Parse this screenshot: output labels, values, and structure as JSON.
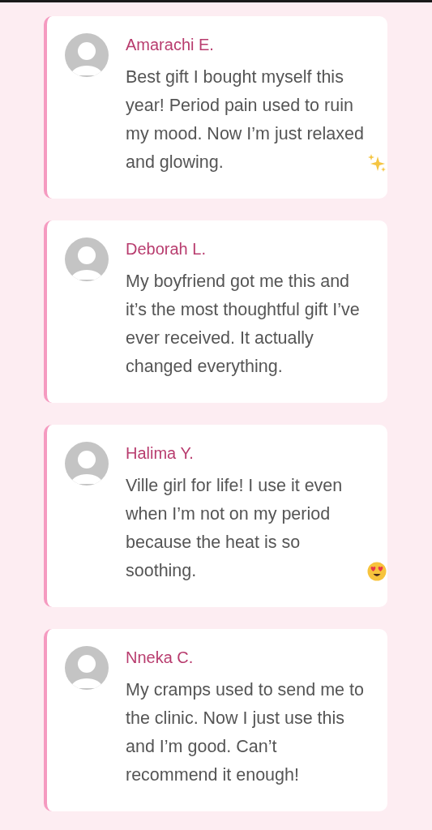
{
  "testimonials": [
    {
      "name": "Amarachi E.",
      "text": "Best gift I bought myself this year! Period pain used to ruin my mood. Now I’m just relaxed and glowing.",
      "kind": "sparkle"
    },
    {
      "name": "Deborah L.",
      "text": "My boyfriend got me this and it’s the most thoughtful gift I’ve ever received. It actually changed everything.",
      "kind": "plain"
    },
    {
      "name": "Halima Y.",
      "text": "Ville girl for life! I use it even when I’m not on my period because the heat is so soothing.",
      "kind": "hearteyes"
    },
    {
      "name": "Nneka C.",
      "text": "My cramps used to send me to the clinic. Now I just use this and I’m good. Can’t recommend it enough!",
      "kind": "plain"
    }
  ]
}
